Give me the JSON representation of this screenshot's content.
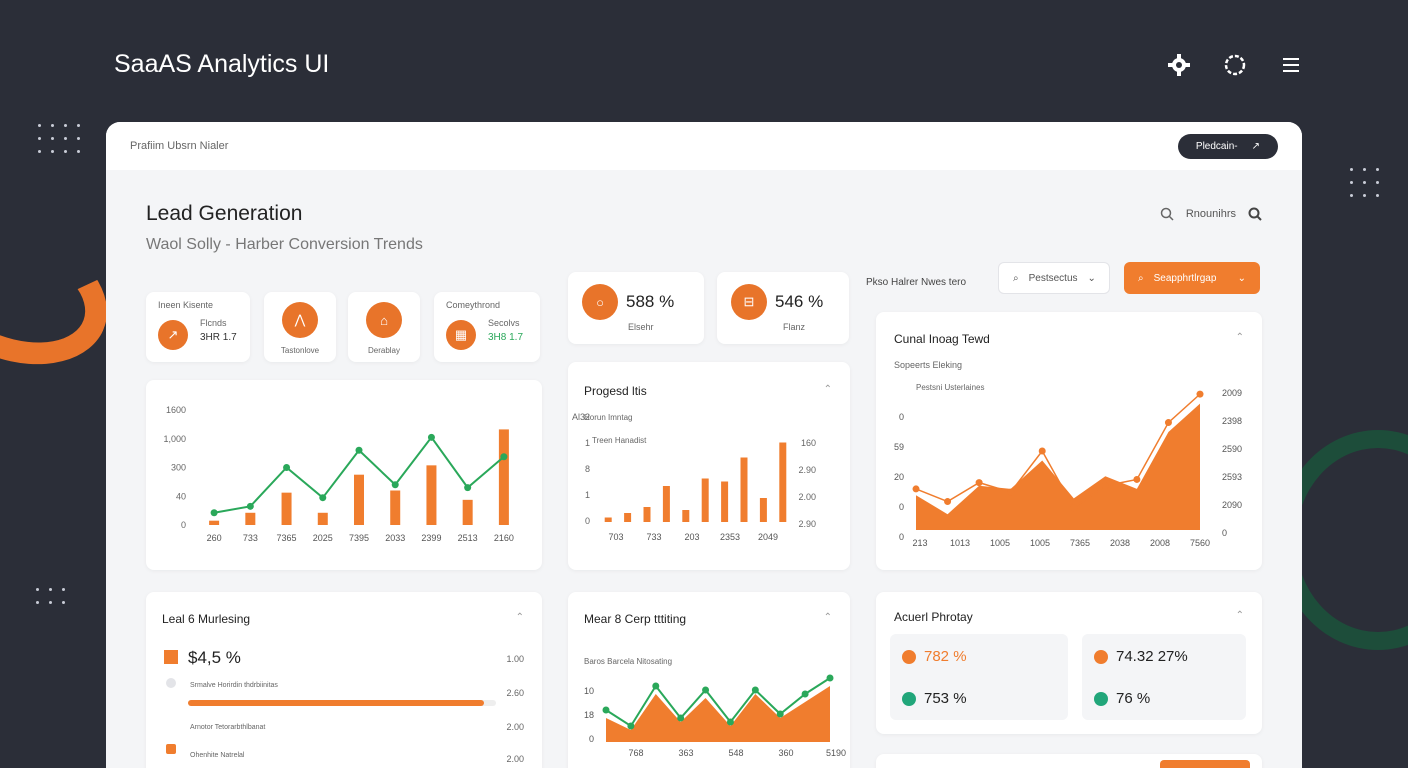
{
  "app_title": "SaaAS Analytics UI",
  "window": {
    "breadcrumb": "Prafiim Ubsrn Nialer",
    "pill_label": "Pledcain-"
  },
  "header": {
    "title": "Lead Generation",
    "subtitle": "Waol Solly - Harber Conversion Trends",
    "search_label": "Rnounihrs"
  },
  "kpis": [
    {
      "label": "Ineen Kisente",
      "sub": "Flcnds",
      "value": "3HR 1.7"
    },
    {
      "label": "Tastonlove"
    },
    {
      "label": "Derablay"
    },
    {
      "label": "Comeythrond",
      "sub": "Secolvs",
      "value": "3H8 1.7"
    }
  ],
  "stats": [
    {
      "value": "588 %",
      "label": "Elsehr"
    },
    {
      "value": "546 %",
      "label": "Flanz"
    }
  ],
  "controls": {
    "filter_label": "Pkso Halrer Nwes tero",
    "search_placeholder": "Pestsectus",
    "action_label": "Seapphrtlrgap"
  },
  "combo_chart": {
    "y_ticks": [
      "1600",
      "1,000",
      "300",
      "40",
      "0"
    ],
    "x_ticks": [
      "260",
      "733",
      "7365",
      "2025",
      "7395",
      "2033",
      "2399",
      "2513",
      "2160"
    ]
  },
  "progress_card": {
    "title": "Progesd ltis",
    "legend_a": "Horun Imntag",
    "legend_b": "Treen Hanadist",
    "left_ticks": [
      "Al32",
      "1",
      "8",
      "1",
      "0"
    ],
    "right_ticks": [
      "160",
      "2.90",
      "2.00",
      "2.90"
    ],
    "x_ticks": [
      "703",
      "733",
      "203",
      "2353",
      "2049"
    ]
  },
  "area_card": {
    "title": "Cunal Inoag Tewd",
    "subtitle": "Sopeerts Eleking",
    "legend": "Pestsni Usterlaines",
    "left_ticks": [
      "0",
      "59",
      "20",
      "0",
      "0"
    ],
    "right_ticks": [
      "2009",
      "2398",
      "2590",
      "2593",
      "2090",
      "0"
    ],
    "x_ticks": [
      "213",
      "1013",
      "1005",
      "1005",
      "7365",
      "2038",
      "2008",
      "7560"
    ]
  },
  "marketing_card": {
    "title": "Leal 6 Murlesing",
    "value": "$4,5 %",
    "row_labels": [
      "Srmalve Horirdin thdrbiinitas",
      "Arnotor Tetorarbthlbanat",
      "Ohenhite Natrelal"
    ],
    "right_ticks": [
      "1.00",
      "2.60",
      "2.00",
      "2.00"
    ]
  },
  "mear_card": {
    "title": "Mear 8 Cerp tttiting",
    "legend": "Baros Barcela Nitosating",
    "left_ticks": [
      "10",
      "18",
      "0"
    ],
    "x_ticks": [
      "768",
      "363",
      "548",
      "360",
      "5190"
    ]
  },
  "advert_card": {
    "title": "Acuerl Phrotay",
    "left": [
      {
        "value": "782 %"
      },
      {
        "value": "753 %"
      }
    ],
    "right": [
      {
        "value": "74.32 27%"
      },
      {
        "value": "76 %"
      }
    ]
  },
  "chart_data": [
    {
      "type": "bar",
      "title": "",
      "categories": [
        "260",
        "733",
        "7365",
        "2025",
        "7395",
        "2033",
        "2399",
        "2513",
        "2160"
      ],
      "series": [
        {
          "values": [
            60,
            170,
            450,
            170,
            700,
            480,
            830,
            350,
            1330
          ]
        },
        {
          "values": [
            170,
            260,
            800,
            380,
            1040,
            560,
            1220,
            520,
            950
          ]
        }
      ],
      "ylim": [
        0,
        1600
      ]
    },
    {
      "type": "bar",
      "title": "Progesd ltis",
      "categories": [
        "703",
        "733",
        "203",
        "2353",
        "2049"
      ],
      "values": [
        0.3,
        0.6,
        1.0,
        2.4,
        0.8,
        2.9,
        2.7,
        4.3,
        1.6,
        5.3
      ],
      "ylim": [
        0,
        6
      ]
    },
    {
      "type": "area",
      "title": "Cunal Inoag Tewd",
      "categories": [
        "213",
        "1013",
        "1005",
        "1005",
        "7365",
        "2038",
        "2008",
        "7560"
      ],
      "series": [
        {
          "values": [
            22,
            10,
            28,
            26,
            44,
            20,
            34,
            26,
            62,
            80
          ]
        },
        {
          "values": [
            26,
            18,
            30,
            24,
            50,
            14,
            28,
            32,
            68,
            86
          ]
        }
      ],
      "ylim": [
        0,
        100
      ]
    },
    {
      "type": "area",
      "title": "Mear 8 Cerp tttiting",
      "categories": [
        "768",
        "363",
        "548",
        "360",
        "5190"
      ],
      "series": [
        {
          "values": [
            6,
            3,
            12,
            5,
            11,
            4,
            12,
            6,
            10,
            14
          ]
        },
        {
          "values": [
            8,
            4,
            14,
            6,
            13,
            5,
            13,
            7,
            12,
            16
          ]
        }
      ],
      "ylim": [
        0,
        20
      ]
    }
  ]
}
